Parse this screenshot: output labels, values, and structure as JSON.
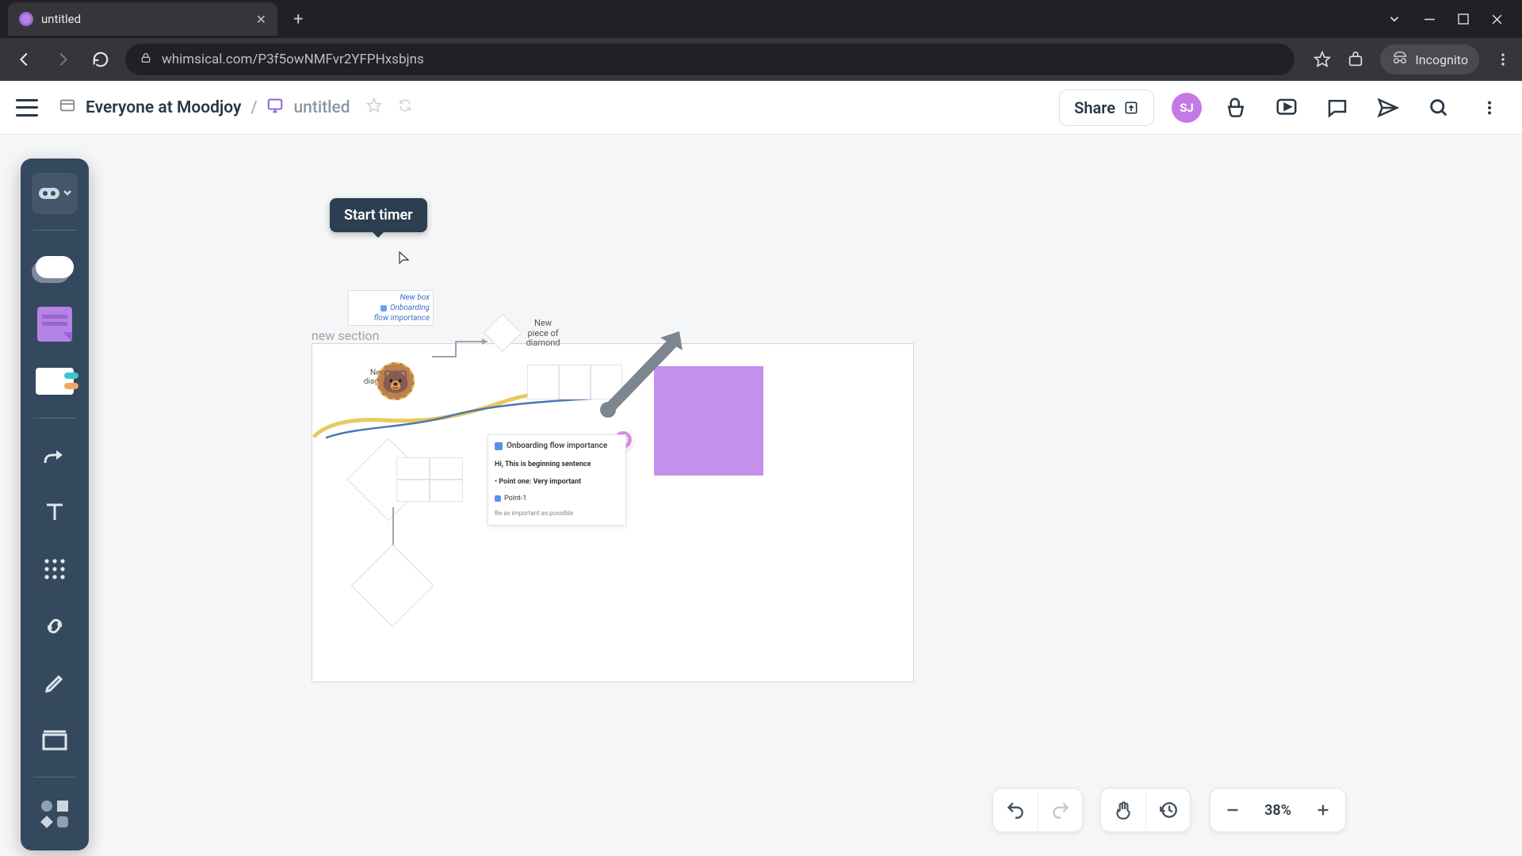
{
  "browser": {
    "tab_title": "untitled",
    "url": "whimsical.com/P3f5owNMFvr2YFPHxsbjns",
    "incognito_label": "Incognito"
  },
  "header": {
    "workspace": "Everyone at Moodjoy",
    "separator": "/",
    "doc_title": "untitled",
    "share_label": "Share",
    "avatar_initials": "SJ"
  },
  "tooltip": {
    "start_timer": "Start timer"
  },
  "canvas": {
    "section_label": "new section",
    "mini": {
      "line1": "New box",
      "line2": "Onboarding",
      "line3": "flow importance"
    },
    "diamond_label": "New piece of diamond",
    "bear_label": "New diagram",
    "doc": {
      "title": "Onboarding flow importance",
      "sentence": "Hi, This is beginning sentence",
      "p1_label": "Point one:",
      "p1_val": "Very important",
      "p2_label": "Point-1",
      "footer": "Be as important as possible"
    },
    "user_badge": "SJ"
  },
  "zoom": {
    "value": "38%"
  }
}
